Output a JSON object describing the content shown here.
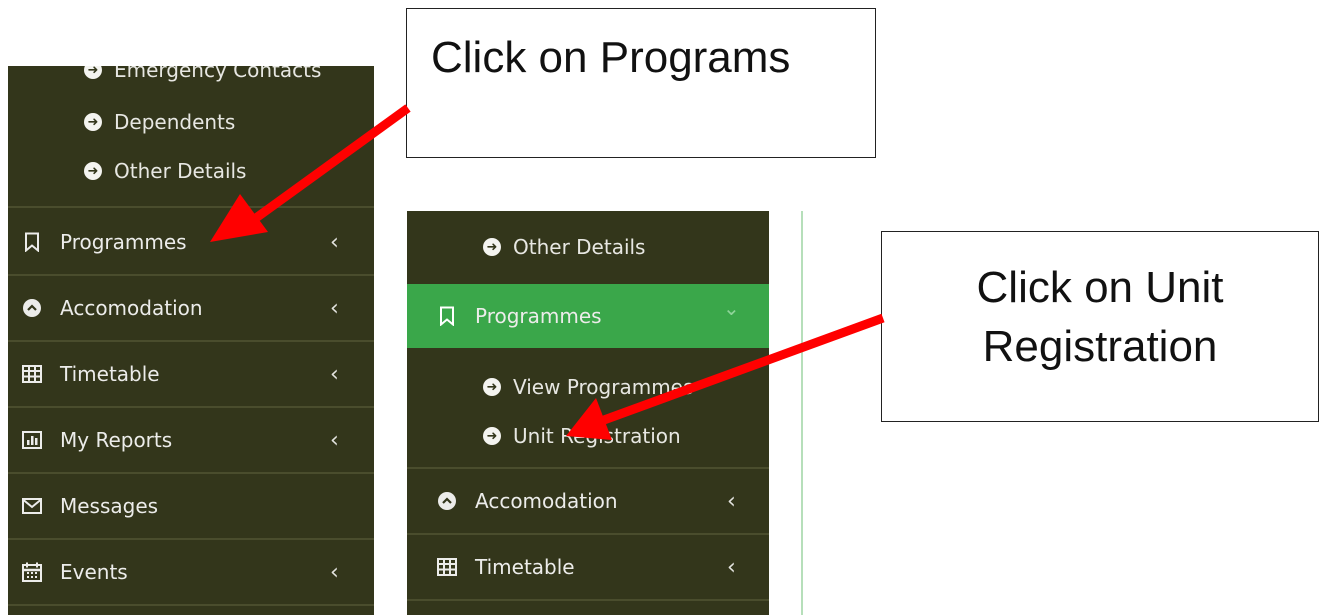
{
  "callouts": {
    "programs": "Click on Programs",
    "unit_line1": "Click on Unit",
    "unit_line2": "Registration"
  },
  "left_panel": {
    "sub_items": [
      {
        "label": "Emergency Contacts"
      },
      {
        "label": "Dependents"
      },
      {
        "label": "Other Details"
      }
    ],
    "menu": [
      {
        "label": "Programmes",
        "icon": "bookmark-icon",
        "chevron": "‹"
      },
      {
        "label": "Accomodation",
        "icon": "chevron-up-circle-icon",
        "chevron": "‹"
      },
      {
        "label": "Timetable",
        "icon": "table-icon",
        "chevron": "‹"
      },
      {
        "label": "My Reports",
        "icon": "bar-chart-icon",
        "chevron": "‹"
      },
      {
        "label": "Messages",
        "icon": "envelope-icon",
        "chevron": ""
      },
      {
        "label": "Events",
        "icon": "calendar-icon",
        "chevron": "‹"
      }
    ]
  },
  "right_panel": {
    "sub_items_top": [
      {
        "label": "Other Details"
      }
    ],
    "active_menu": {
      "label": "Programmes",
      "icon": "bookmark-icon",
      "chevron": "⌄"
    },
    "sub_items_programmes": [
      {
        "label": "View Programmes"
      },
      {
        "label": "Unit Registration"
      }
    ],
    "menu": [
      {
        "label": "Accomodation",
        "icon": "chevron-up-circle-icon",
        "chevron": "‹"
      },
      {
        "label": "Timetable",
        "icon": "table-icon",
        "chevron": "‹"
      }
    ]
  },
  "colors": {
    "sidebar_bg": "#33361b",
    "active_bg": "#3aa74a",
    "arrow": "#ff0000"
  }
}
